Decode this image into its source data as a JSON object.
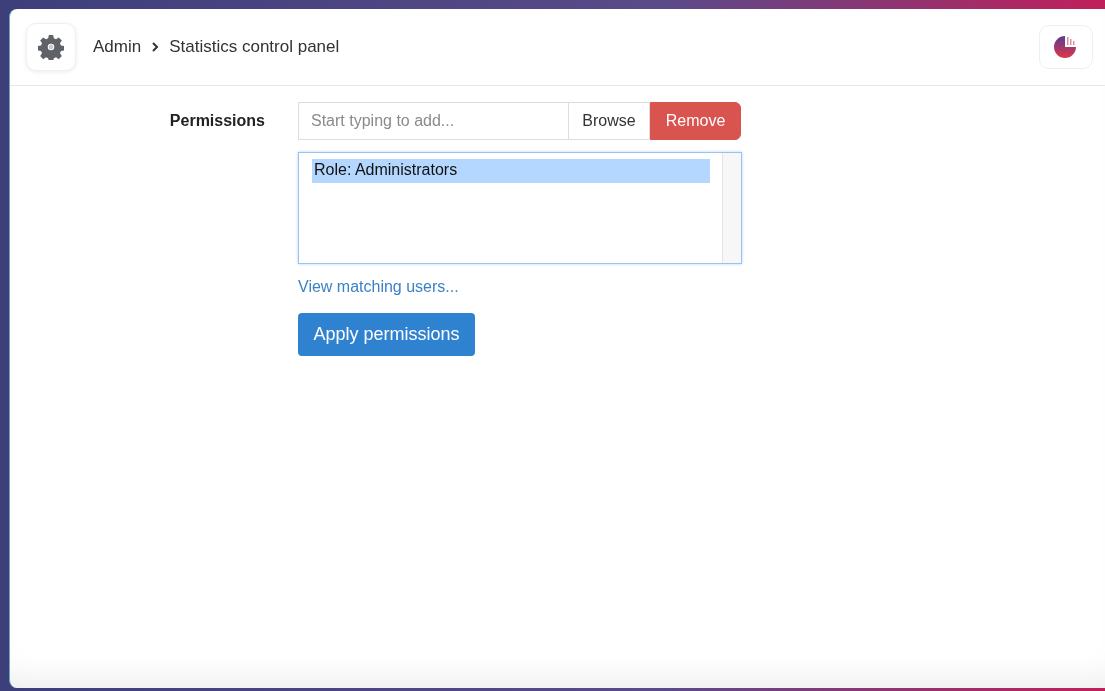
{
  "header": {
    "breadcrumb": [
      {
        "label": "Admin"
      },
      {
        "label": "Statistics control panel"
      }
    ]
  },
  "permissions": {
    "label": "Permissions",
    "search": {
      "placeholder": "Start typing to add..."
    },
    "buttons": [
      {
        "label": "Browse",
        "kind": "plain"
      },
      {
        "label": "Remove",
        "kind": "danger"
      }
    ],
    "items": [
      {
        "label": "Role: Administrators",
        "selected": true
      }
    ],
    "link": "View matching users...",
    "apply": "Apply permissions"
  }
}
